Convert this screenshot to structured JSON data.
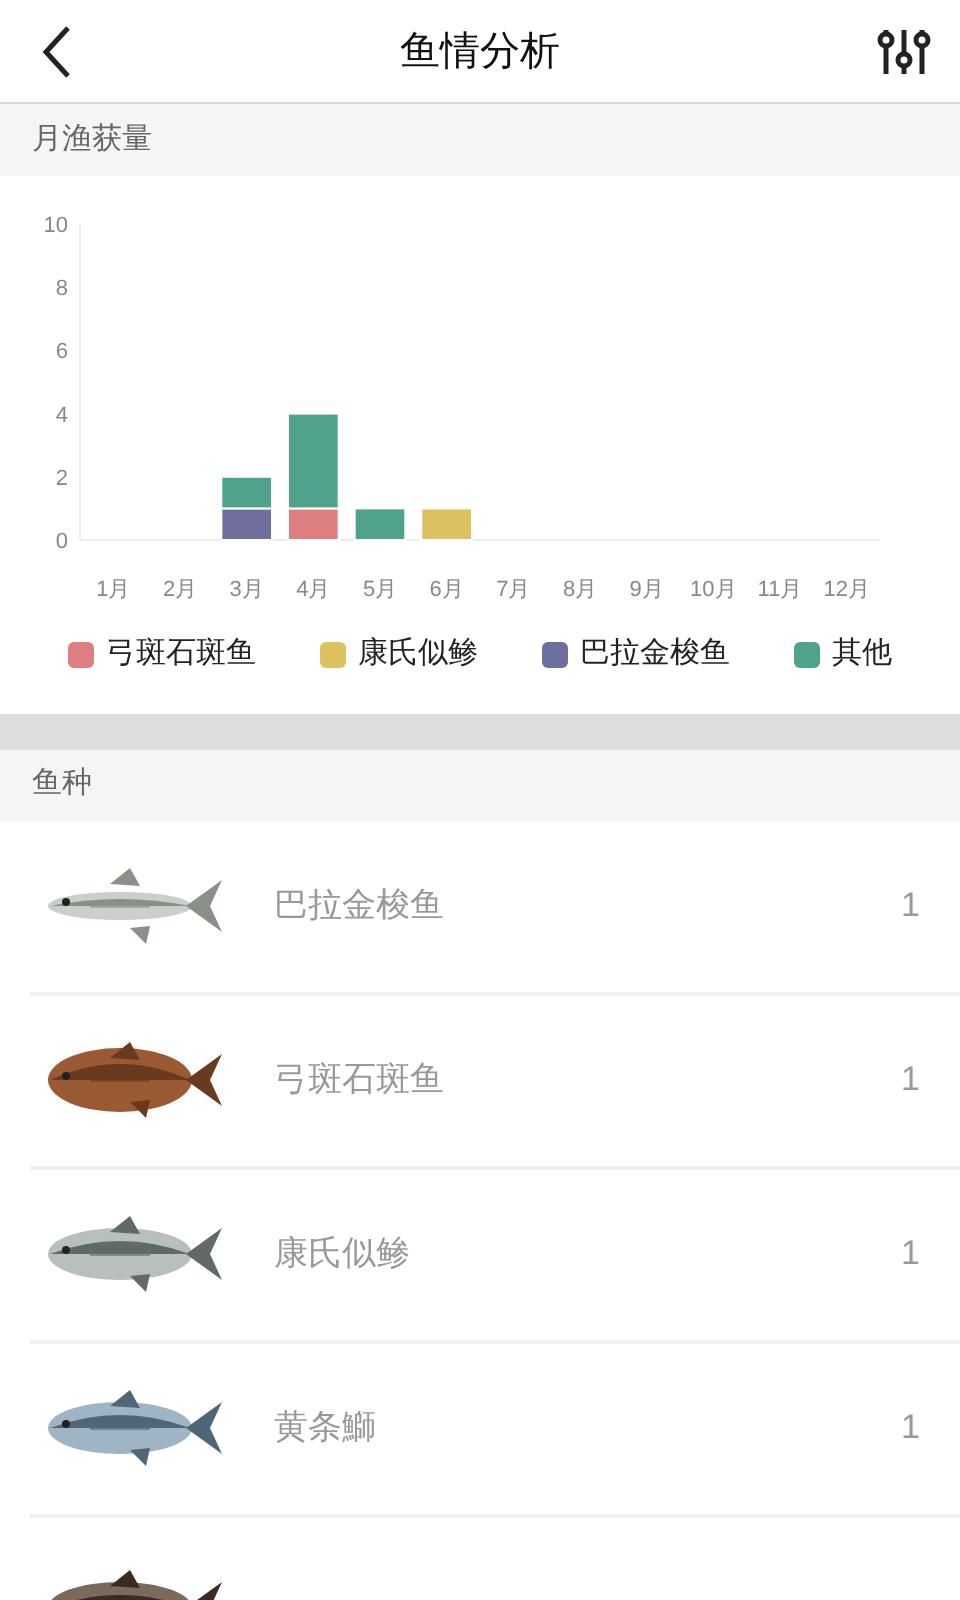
{
  "header": {
    "title": "鱼情分析"
  },
  "catch_section": {
    "title": "月渔获量",
    "chart_data": {
      "type": "bar",
      "stacked": true,
      "legend": "bottom",
      "categories": [
        "1月",
        "2月",
        "3月",
        "4月",
        "5月",
        "6月",
        "7月",
        "8月",
        "9月",
        "10月",
        "11月",
        "12月"
      ],
      "ylim": [
        0,
        10
      ],
      "yticks": [
        0,
        2,
        4,
        6,
        8,
        10
      ],
      "series": [
        {
          "name": "弓斑石斑鱼",
          "color": "#dd7e80",
          "values": [
            0,
            0,
            0,
            1,
            0,
            0,
            0,
            0,
            0,
            0,
            0,
            0
          ]
        },
        {
          "name": "康氏似鲹",
          "color": "#dcc25e",
          "values": [
            0,
            0,
            0,
            0,
            0,
            1,
            0,
            0,
            0,
            0,
            0,
            0
          ]
        },
        {
          "name": "巴拉金梭鱼",
          "color": "#6e6f9c",
          "values": [
            0,
            0,
            1,
            0,
            0,
            0,
            0,
            0,
            0,
            0,
            0,
            0
          ]
        },
        {
          "name": "其他",
          "color": "#4fa38d",
          "values": [
            0,
            0,
            1,
            3,
            1,
            0,
            0,
            0,
            0,
            0,
            0,
            0
          ]
        }
      ]
    }
  },
  "species_section": {
    "title": "鱼种",
    "items": [
      {
        "kind": "row",
        "name": "巴拉金梭鱼",
        "count": "1"
      },
      {
        "kind": "row",
        "name": "弓斑石斑鱼",
        "count": "1"
      },
      {
        "kind": "row",
        "name": "康氏似鲹",
        "count": "1"
      },
      {
        "kind": "row",
        "name": "黄条鰤",
        "count": "1"
      },
      {
        "kind": "picture"
      }
    ]
  }
}
